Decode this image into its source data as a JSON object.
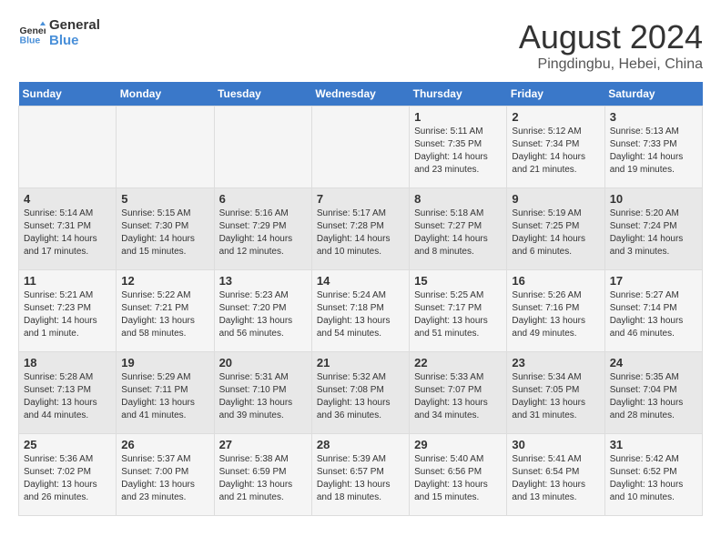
{
  "header": {
    "logo_line1": "General",
    "logo_line2": "Blue",
    "title": "August 2024",
    "subtitle": "Pingdingbu, Hebei, China"
  },
  "days_of_week": [
    "Sunday",
    "Monday",
    "Tuesday",
    "Wednesday",
    "Thursday",
    "Friday",
    "Saturday"
  ],
  "weeks": [
    [
      {
        "day": "",
        "detail": ""
      },
      {
        "day": "",
        "detail": ""
      },
      {
        "day": "",
        "detail": ""
      },
      {
        "day": "",
        "detail": ""
      },
      {
        "day": "1",
        "detail": "Sunrise: 5:11 AM\nSunset: 7:35 PM\nDaylight: 14 hours\nand 23 minutes."
      },
      {
        "day": "2",
        "detail": "Sunrise: 5:12 AM\nSunset: 7:34 PM\nDaylight: 14 hours\nand 21 minutes."
      },
      {
        "day": "3",
        "detail": "Sunrise: 5:13 AM\nSunset: 7:33 PM\nDaylight: 14 hours\nand 19 minutes."
      }
    ],
    [
      {
        "day": "4",
        "detail": "Sunrise: 5:14 AM\nSunset: 7:31 PM\nDaylight: 14 hours\nand 17 minutes."
      },
      {
        "day": "5",
        "detail": "Sunrise: 5:15 AM\nSunset: 7:30 PM\nDaylight: 14 hours\nand 15 minutes."
      },
      {
        "day": "6",
        "detail": "Sunrise: 5:16 AM\nSunset: 7:29 PM\nDaylight: 14 hours\nand 12 minutes."
      },
      {
        "day": "7",
        "detail": "Sunrise: 5:17 AM\nSunset: 7:28 PM\nDaylight: 14 hours\nand 10 minutes."
      },
      {
        "day": "8",
        "detail": "Sunrise: 5:18 AM\nSunset: 7:27 PM\nDaylight: 14 hours\nand 8 minutes."
      },
      {
        "day": "9",
        "detail": "Sunrise: 5:19 AM\nSunset: 7:25 PM\nDaylight: 14 hours\nand 6 minutes."
      },
      {
        "day": "10",
        "detail": "Sunrise: 5:20 AM\nSunset: 7:24 PM\nDaylight: 14 hours\nand 3 minutes."
      }
    ],
    [
      {
        "day": "11",
        "detail": "Sunrise: 5:21 AM\nSunset: 7:23 PM\nDaylight: 14 hours\nand 1 minute."
      },
      {
        "day": "12",
        "detail": "Sunrise: 5:22 AM\nSunset: 7:21 PM\nDaylight: 13 hours\nand 58 minutes."
      },
      {
        "day": "13",
        "detail": "Sunrise: 5:23 AM\nSunset: 7:20 PM\nDaylight: 13 hours\nand 56 minutes."
      },
      {
        "day": "14",
        "detail": "Sunrise: 5:24 AM\nSunset: 7:18 PM\nDaylight: 13 hours\nand 54 minutes."
      },
      {
        "day": "15",
        "detail": "Sunrise: 5:25 AM\nSunset: 7:17 PM\nDaylight: 13 hours\nand 51 minutes."
      },
      {
        "day": "16",
        "detail": "Sunrise: 5:26 AM\nSunset: 7:16 PM\nDaylight: 13 hours\nand 49 minutes."
      },
      {
        "day": "17",
        "detail": "Sunrise: 5:27 AM\nSunset: 7:14 PM\nDaylight: 13 hours\nand 46 minutes."
      }
    ],
    [
      {
        "day": "18",
        "detail": "Sunrise: 5:28 AM\nSunset: 7:13 PM\nDaylight: 13 hours\nand 44 minutes."
      },
      {
        "day": "19",
        "detail": "Sunrise: 5:29 AM\nSunset: 7:11 PM\nDaylight: 13 hours\nand 41 minutes."
      },
      {
        "day": "20",
        "detail": "Sunrise: 5:31 AM\nSunset: 7:10 PM\nDaylight: 13 hours\nand 39 minutes."
      },
      {
        "day": "21",
        "detail": "Sunrise: 5:32 AM\nSunset: 7:08 PM\nDaylight: 13 hours\nand 36 minutes."
      },
      {
        "day": "22",
        "detail": "Sunrise: 5:33 AM\nSunset: 7:07 PM\nDaylight: 13 hours\nand 34 minutes."
      },
      {
        "day": "23",
        "detail": "Sunrise: 5:34 AM\nSunset: 7:05 PM\nDaylight: 13 hours\nand 31 minutes."
      },
      {
        "day": "24",
        "detail": "Sunrise: 5:35 AM\nSunset: 7:04 PM\nDaylight: 13 hours\nand 28 minutes."
      }
    ],
    [
      {
        "day": "25",
        "detail": "Sunrise: 5:36 AM\nSunset: 7:02 PM\nDaylight: 13 hours\nand 26 minutes."
      },
      {
        "day": "26",
        "detail": "Sunrise: 5:37 AM\nSunset: 7:00 PM\nDaylight: 13 hours\nand 23 minutes."
      },
      {
        "day": "27",
        "detail": "Sunrise: 5:38 AM\nSunset: 6:59 PM\nDaylight: 13 hours\nand 21 minutes."
      },
      {
        "day": "28",
        "detail": "Sunrise: 5:39 AM\nSunset: 6:57 PM\nDaylight: 13 hours\nand 18 minutes."
      },
      {
        "day": "29",
        "detail": "Sunrise: 5:40 AM\nSunset: 6:56 PM\nDaylight: 13 hours\nand 15 minutes."
      },
      {
        "day": "30",
        "detail": "Sunrise: 5:41 AM\nSunset: 6:54 PM\nDaylight: 13 hours\nand 13 minutes."
      },
      {
        "day": "31",
        "detail": "Sunrise: 5:42 AM\nSunset: 6:52 PM\nDaylight: 13 hours\nand 10 minutes."
      }
    ]
  ]
}
